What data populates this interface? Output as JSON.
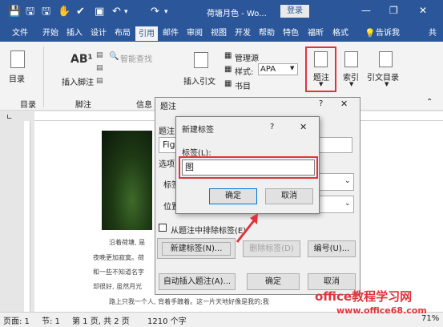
{
  "window": {
    "title": "荷塘月色 - Wo...",
    "login_label": "登录",
    "min": "—",
    "restore": "❐",
    "close": "✕"
  },
  "quick_access": [
    "💾",
    "🖫",
    "🖫",
    "✋",
    "✔",
    "▣",
    "↶",
    "▾",
    "↷",
    "▾"
  ],
  "tabs": [
    "文件",
    "开始",
    "插入",
    "设计",
    "布局",
    "引用",
    "邮件",
    "审阅",
    "视图",
    "开发",
    "帮助",
    "特色",
    "福昕",
    "格式"
  ],
  "tell_me": "告诉我",
  "user_initial": "共",
  "ribbon": {
    "toc_label": "目录",
    "toc_group": "目录",
    "insert_footnote": "插入脚注",
    "footnote_group": "脚注",
    "smart_lookup": "智能查找",
    "info_group": "信息",
    "insert_citation": "插入引文",
    "manage_sources": "管理源",
    "style_label": "样式:",
    "style_value": "APA",
    "bibliography": "书目",
    "caption_btn": "题注",
    "index_btn": "索引",
    "toa_btn": "引文目录"
  },
  "caption_dialog": {
    "title": "题注",
    "help": "?",
    "close": "✕",
    "caption_label": "题注",
    "caption_value": "Fig",
    "options_label": "选项",
    "label_label": "标签",
    "position_label": "位置",
    "exclude_label": "从题注中排除标签(E)",
    "new_label_btn": "新建标签(N)...",
    "delete_label_btn": "删除标签(D)",
    "numbering_btn": "编号(U)...",
    "auto_caption_btn": "自动插入题注(A)...",
    "ok": "确定",
    "cancel": "取消"
  },
  "new_label_dialog": {
    "title": "新建标签",
    "help": "?",
    "close": "✕",
    "label_caption": "标签(L):",
    "label_value": "图",
    "ok": "确定",
    "cancel": "取消"
  },
  "doc_text": [
    "沿着荷塘, 是",
    "夜晚更加寂寞。荷",
    "和一些不知道名字",
    "却很好, 虽然月光",
    "路上只我一个人, 背着手踱着。这一片天地好像是我的;我"
  ],
  "status": {
    "page": "页面: 1",
    "section": "节: 1",
    "page_of": "第 1 页, 共 2 页",
    "words": "1210 个字",
    "zoom": "71%"
  },
  "watermark": {
    "text": "office教程学习网",
    "url": "www.office68.com"
  }
}
